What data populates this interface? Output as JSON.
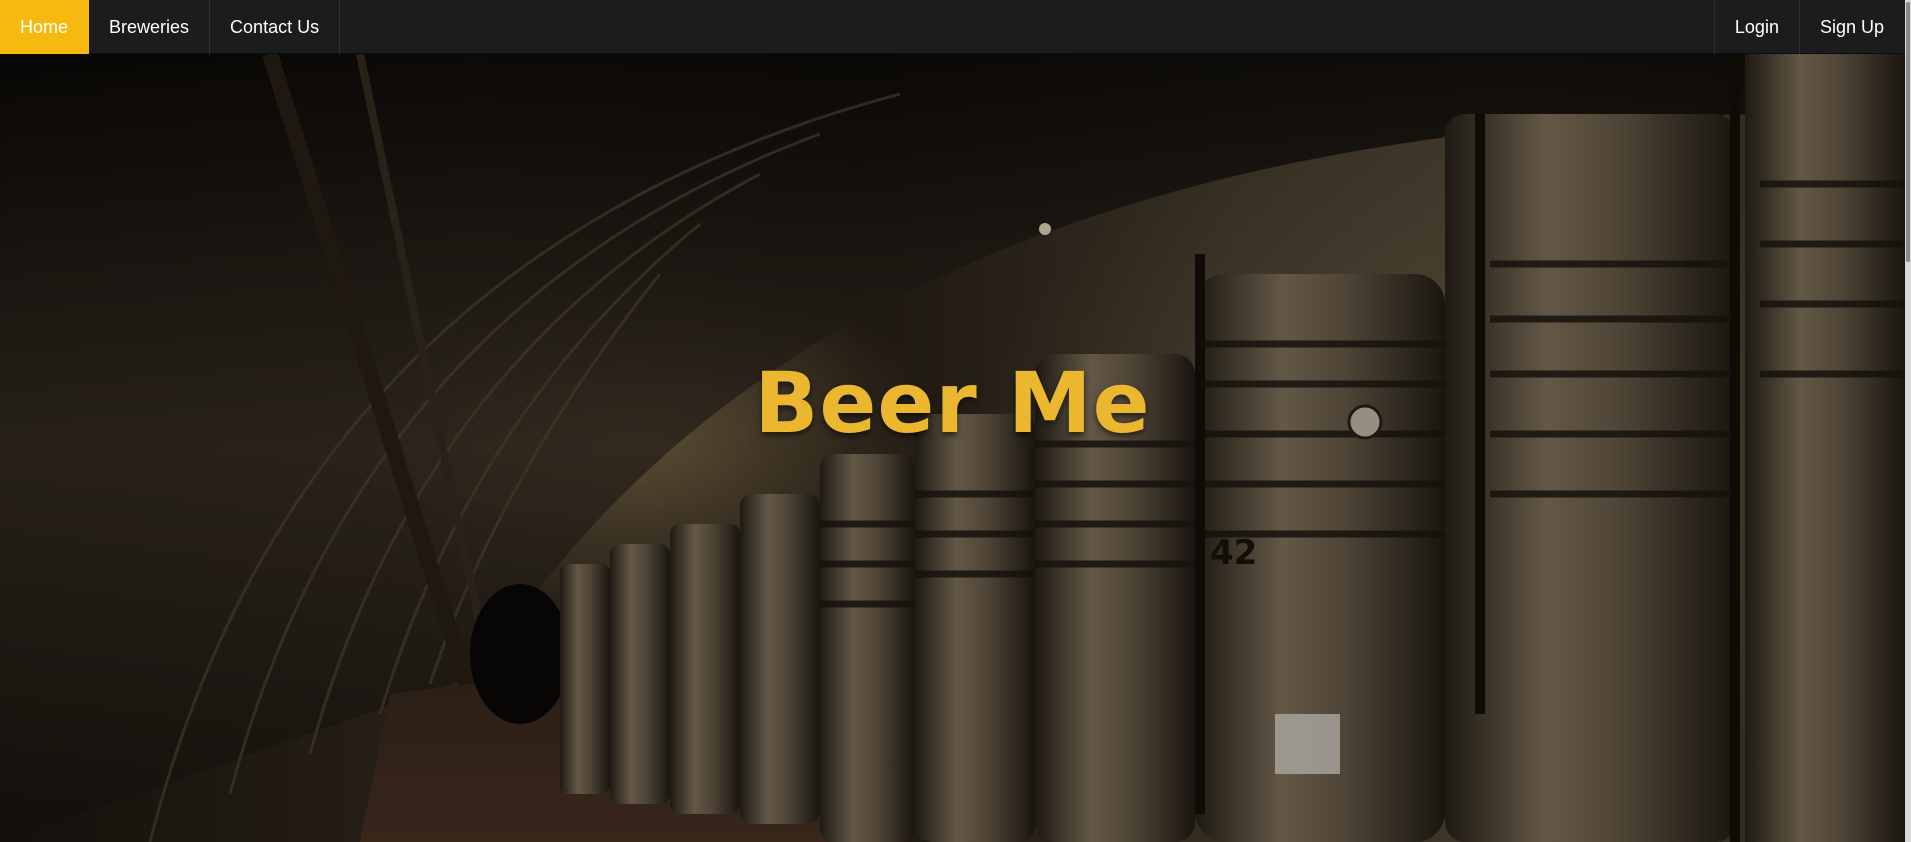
{
  "nav": {
    "left": [
      {
        "label": "Home",
        "active": true
      },
      {
        "label": "Breweries",
        "active": false
      },
      {
        "label": "Contact Us",
        "active": false
      }
    ],
    "right": [
      {
        "label": "Login"
      },
      {
        "label": "Sign Up"
      }
    ]
  },
  "hero": {
    "title": "Beer Me",
    "background_description_icon": "brewery-cellar-image"
  },
  "colors": {
    "accent": "#f6b90f",
    "title": "#ebb72f",
    "navbar": "#1b1c1e"
  }
}
